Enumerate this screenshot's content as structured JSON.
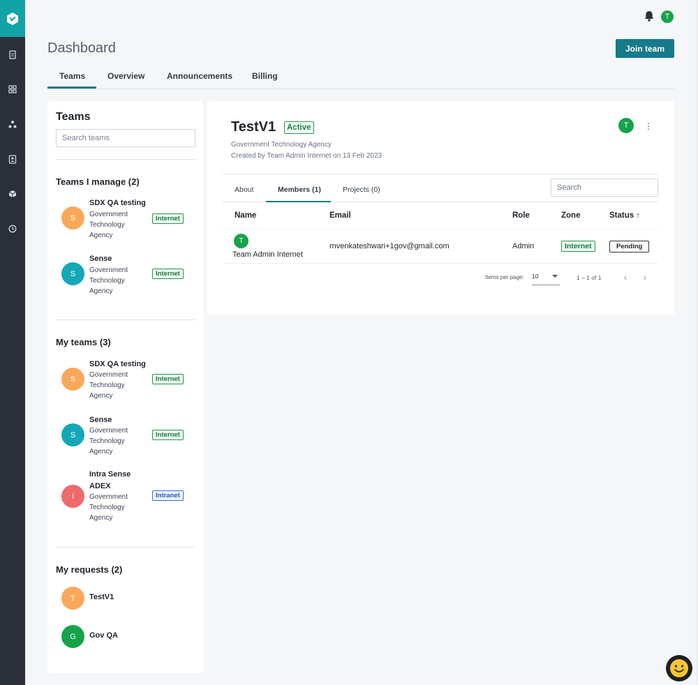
{
  "header": {
    "page_title": "Dashboard",
    "join_button": "Join team",
    "avatar_initial": "T"
  },
  "main_tabs": [
    {
      "label": "Teams",
      "active": true
    },
    {
      "label": "Overview",
      "active": false
    },
    {
      "label": "Announcements",
      "active": false
    },
    {
      "label": "Billing",
      "active": false
    }
  ],
  "sidebar": {
    "icons": [
      "logo-icon",
      "documents-icon",
      "apps-grid-icon",
      "network-icon",
      "contacts-icon",
      "package-icon",
      "clock-icon"
    ]
  },
  "left_panel": {
    "title": "Teams",
    "search_placeholder": "Search teams",
    "manage_heading": "Teams I manage (2)",
    "manage_teams": [
      {
        "initial": "S",
        "name": "SDX QA testing",
        "org_line1": "Government",
        "org_line2": "Technology",
        "org_line3": "Agency",
        "zone": "Internet",
        "color": "#f9a85a"
      },
      {
        "initial": "S",
        "name": "Sense",
        "org_line1": "Government",
        "org_line2": "Technology",
        "org_line3": "Agency",
        "zone": "Internet",
        "color": "#14a8b6"
      }
    ],
    "my_teams_heading": "My teams (3)",
    "my_teams": [
      {
        "initial": "S",
        "name": "SDX QA testing",
        "org_line1": "Government",
        "org_line2": "Technology",
        "org_line3": "Agency",
        "zone": "Internet",
        "color": "#f9a85a"
      },
      {
        "initial": "S",
        "name": "Sense",
        "org_line1": "Government",
        "org_line2": "Technology",
        "org_line3": "Agency",
        "zone": "Internet",
        "color": "#14a8b6"
      },
      {
        "initial": "I",
        "name_line1": "Intra Sense",
        "name_line2": "ADEX",
        "org_line1": "Government",
        "org_line2": "Technology",
        "org_line3": "Agency",
        "zone": "Intranet",
        "color": "#f0696b"
      }
    ],
    "requests_heading": "My requests (2)",
    "requests": [
      {
        "initial": "T",
        "name": "TestV1",
        "color": "#f9a85a"
      },
      {
        "initial": "G",
        "name": "Gov QA",
        "color": "#16a34a"
      }
    ]
  },
  "team_detail": {
    "title": "TestV1",
    "status": "Active",
    "org": "Government Technology Agency",
    "created": "Created by Team Admin Internet on 13 Feb 2023",
    "owner_initial": "T",
    "more_label": "⋮",
    "tabs": [
      {
        "label": "About",
        "active": false
      },
      {
        "label": "Members (1)",
        "active": true
      },
      {
        "label": "Projects (0)",
        "active": false
      }
    ],
    "search_placeholder": "Search",
    "table": {
      "headers": [
        "Name",
        "Email",
        "Role",
        "Zone",
        "Status"
      ],
      "sort_indicator": "↑",
      "rows": [
        {
          "initial": "T",
          "name": "Team Admin Internet",
          "email": "rnvenkateshwari+1gov@gmail.com",
          "role": "Admin",
          "zone": "Internet",
          "status": "Pending"
        }
      ]
    },
    "pagination": {
      "items_per_page_label": "Items per page:",
      "items_per_page": "10",
      "range": "1 – 1 of 1",
      "prev": "‹",
      "next": "›"
    }
  },
  "colors": {
    "accent": "#167a8a",
    "sidebar": "#2a2f3a",
    "logo": "#12a3a8",
    "success": "#16a34a"
  }
}
